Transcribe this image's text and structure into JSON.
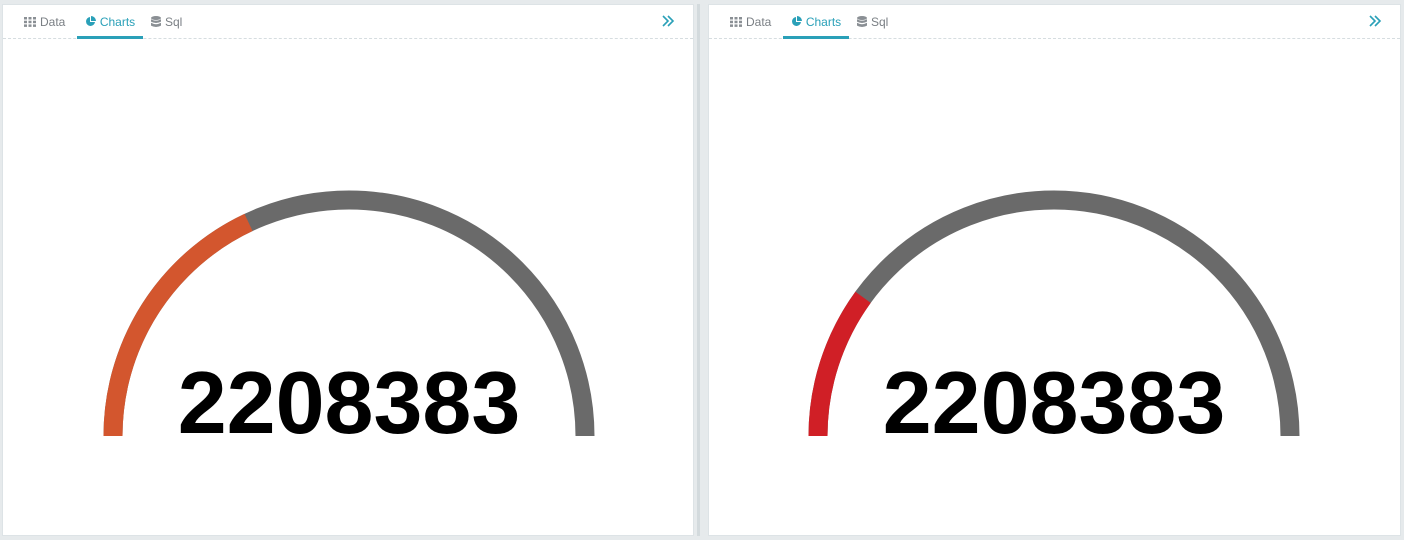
{
  "colors": {
    "accent": "#2aa0b8",
    "gauge_track": "#6a6a6a",
    "gauge_value_left": "#d3562e",
    "gauge_value_right": "#d01f26"
  },
  "panels": [
    {
      "tabs": [
        {
          "label": "Data",
          "icon": "grid-icon"
        },
        {
          "label": "Charts",
          "icon": "pie-chart-icon",
          "active": true
        },
        {
          "label": "Sql",
          "icon": "database-icon"
        }
      ],
      "expand_icon": "double-chevron-right-icon",
      "gauge": {
        "value_text": "2208383",
        "fill_fraction": 0.36
      }
    },
    {
      "tabs": [
        {
          "label": "Data",
          "icon": "grid-icon"
        },
        {
          "label": "Charts",
          "icon": "pie-chart-icon",
          "active": true
        },
        {
          "label": "Sql",
          "icon": "database-icon"
        }
      ],
      "expand_icon": "double-chevron-right-icon",
      "gauge": {
        "value_text": "2208383",
        "fill_fraction": 0.2
      }
    }
  ]
}
